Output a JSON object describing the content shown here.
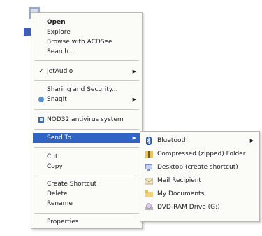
{
  "context_menu": {
    "open": "Open",
    "explore": "Explore",
    "browse_acdsee": "Browse with ACDSee",
    "search": "Search...",
    "jetaudio": "JetAudio",
    "sharing_security": "Sharing and Security...",
    "snagit": "SnagIt",
    "nod32": "NOD32 antivirus system",
    "send_to": "Send To",
    "cut": "Cut",
    "copy": "Copy",
    "create_shortcut": "Create Shortcut",
    "delete": "Delete",
    "rename": "Rename",
    "properties": "Properties"
  },
  "send_to_menu": {
    "bluetooth": "Bluetooth",
    "compressed": "Compressed (zipped) Folder",
    "desktop": "Desktop (create shortcut)",
    "mail": "Mail Recipient",
    "my_documents": "My Documents",
    "dvd": "DVD-RAM Drive (G:)"
  },
  "icons": {
    "checkmark": "✓",
    "submenu_arrow": "▶"
  },
  "colors": {
    "highlight": "#3163c5",
    "menu_bg": "#fbfbf8"
  }
}
